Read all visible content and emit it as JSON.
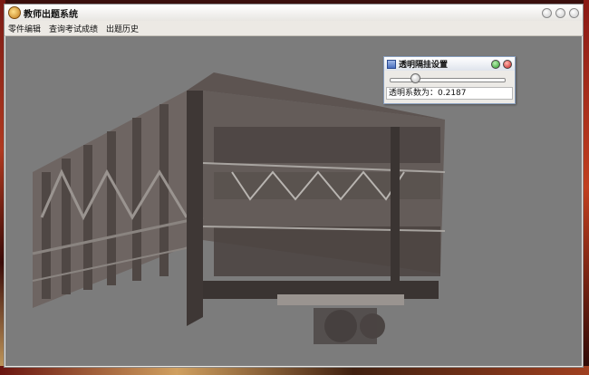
{
  "window": {
    "title": "教师出题系统",
    "buttons": [
      "minimize-button",
      "maximize-button",
      "close-button"
    ]
  },
  "menu": [
    "零件编辑",
    "查询考试成绩",
    "出题历史"
  ],
  "dialog": {
    "title": "透明隔挂设置",
    "slider": {
      "min": 0,
      "max": 1,
      "value": 0.2187
    },
    "readout_label": "透明系数为：",
    "readout_value": "0.2187"
  },
  "icons": {
    "app": "teacher-app-icon",
    "dialog": "window-icon",
    "dialog_ok": "green-circle-icon",
    "dialog_close": "red-circle-icon"
  },
  "colors": {
    "viewport_bg": "#7c7c7c",
    "window_chrome": "#ece9e4"
  }
}
